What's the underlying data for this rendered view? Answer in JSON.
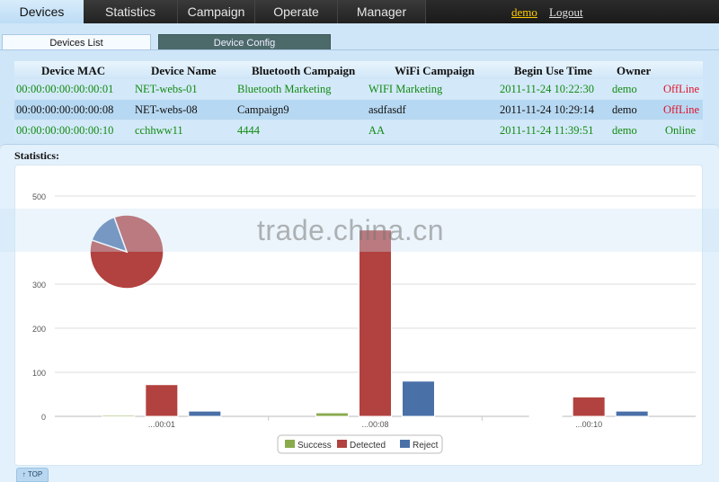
{
  "nav": {
    "tabs": [
      "Devices",
      "Statistics",
      "Campaign",
      "Operate",
      "Manager"
    ],
    "active": 0,
    "user_link": "demo",
    "logout_link": "Logout"
  },
  "subtabs": {
    "list": "Devices List",
    "config": "Device Config"
  },
  "table": {
    "headers": [
      "Device MAC",
      "Device Name",
      "Bluetooth Campaign",
      "WiFi Campaign",
      "Begin Use Time",
      "Owner"
    ],
    "rows": [
      {
        "mac": "00:00:00:00:00:00:01",
        "name": "NET-webs-01",
        "bt": "Bluetooth Marketing",
        "wifi": "WIFI Marketing",
        "time": "2011-11-24 10:22:30",
        "owner": "demo",
        "status": "OffLine"
      },
      {
        "mac": "00:00:00:00:00:00:08",
        "name": "NET-webs-08",
        "bt": "Campaign9",
        "wifi": "asdfasdf",
        "time": "2011-11-24 10:29:14",
        "owner": "demo",
        "status": "OffLine"
      },
      {
        "mac": "00:00:00:00:00:00:10",
        "name": "cchhww11",
        "bt": "4444",
        "wifi": "AA",
        "time": "2011-11-24 11:39:51",
        "owner": "demo",
        "status": "Online"
      }
    ]
  },
  "stats_title": "Statistics:",
  "watermark": "trade.china.cn",
  "top_button": "TOP",
  "colors": {
    "success": "#8aab4c",
    "detected": "#b2423f",
    "reject": "#4a70a8"
  },
  "chart_data": {
    "type": "bar",
    "categories": [
      "...00:01",
      "...00:08",
      "...00:10"
    ],
    "series": [
      {
        "name": "Success",
        "values": [
          3,
          8,
          1
        ]
      },
      {
        "name": "Detected",
        "values": [
          72,
          423,
          44
        ]
      },
      {
        "name": "Reject",
        "values": [
          12,
          80,
          12
        ]
      }
    ],
    "ylim": [
      0,
      500
    ],
    "yticks": [
      0,
      100,
      200,
      300,
      500
    ],
    "grid": true,
    "legend": "bottom",
    "pie": {
      "values": [
        72,
        12
      ],
      "colors": [
        "#b2423f",
        "#4a70a8"
      ]
    }
  }
}
